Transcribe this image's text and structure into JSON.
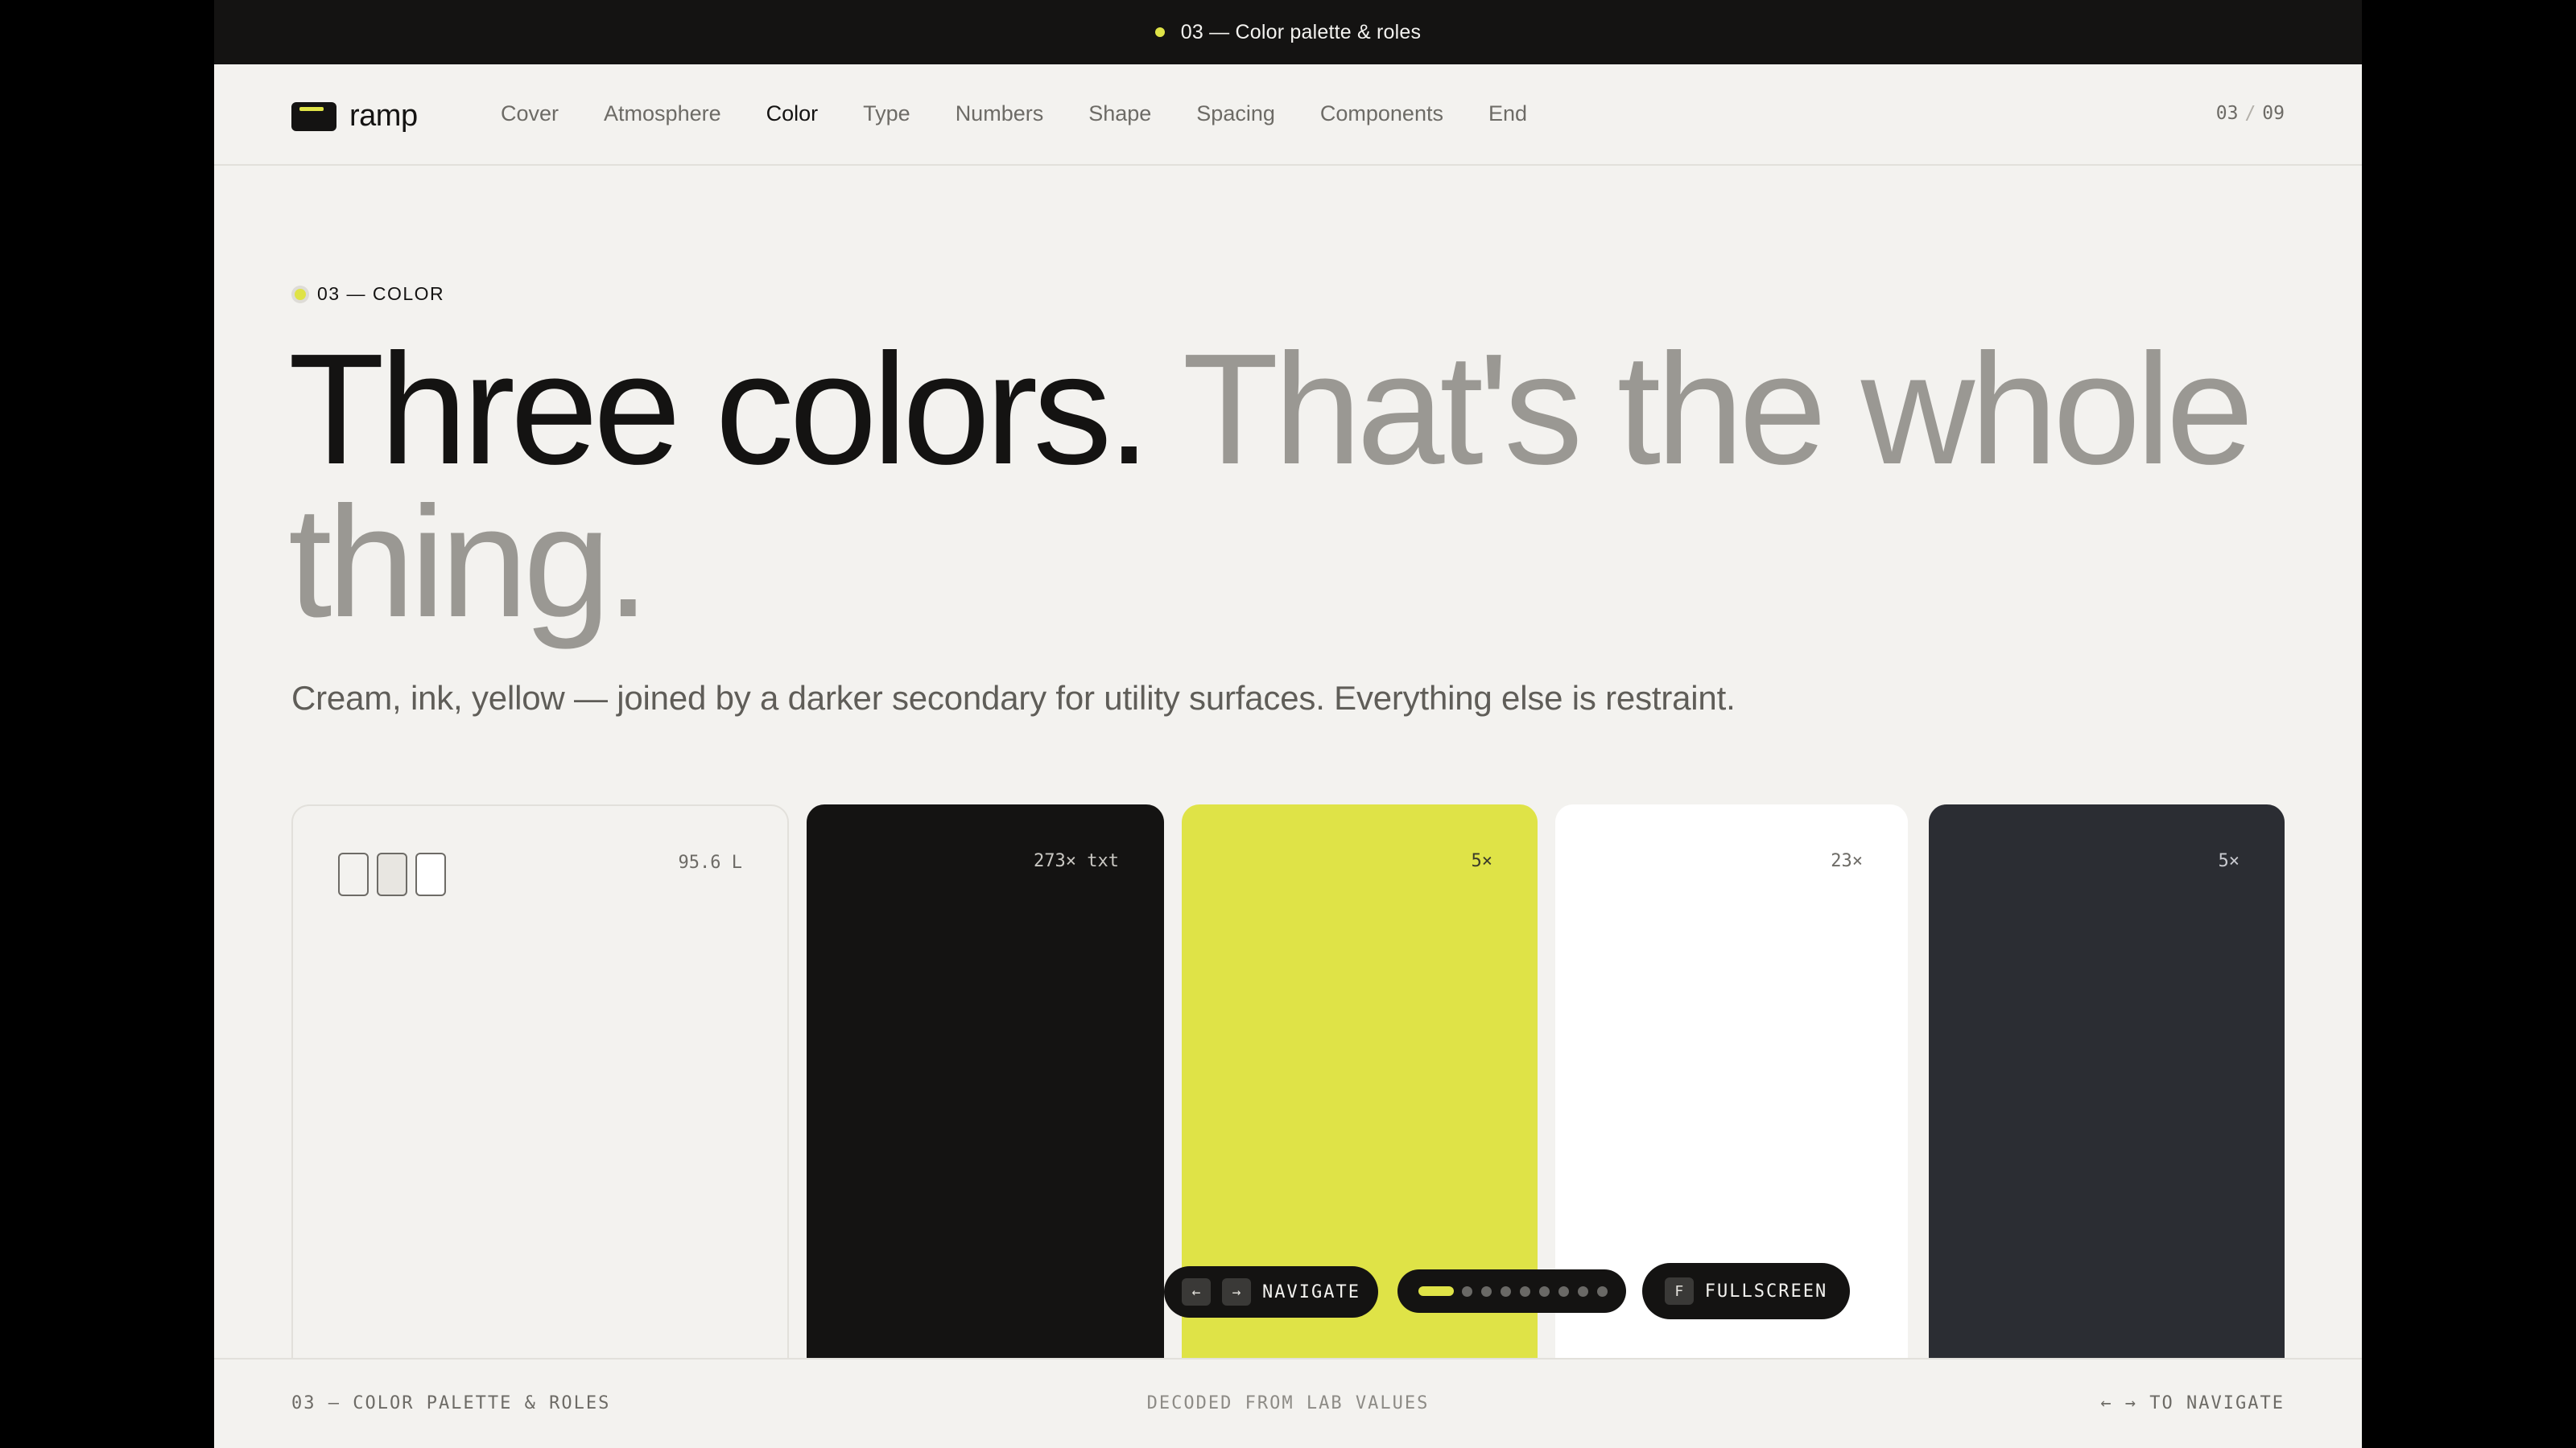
{
  "topbar": {
    "title": "03 — Color palette & roles"
  },
  "brand": {
    "name": "ramp"
  },
  "nav": {
    "items": [
      "Cover",
      "Atmosphere",
      "Color",
      "Type",
      "Numbers",
      "Shape",
      "Spacing",
      "Components",
      "End"
    ],
    "active": "Color",
    "page_current": "03",
    "page_separator": "/",
    "page_total": "09"
  },
  "section": {
    "label": "03 — COLOR"
  },
  "headline": {
    "primary": "Three colors.",
    "secondary": "That's the whole thing."
  },
  "subtitle": "Cream, ink, yellow — joined by a darker secondary for utility surfaces. Everything else is restraint.",
  "swatches": [
    {
      "meta": "95.6 L",
      "color": "#f3f2ef"
    },
    {
      "meta": "273× txt",
      "color": "#141312"
    },
    {
      "meta": "5×",
      "color": "#dfe347"
    },
    {
      "meta": "23×",
      "color": "#ffffff"
    },
    {
      "meta": "5×",
      "color": "#2b2d33"
    }
  ],
  "controls": {
    "prev_key": "←",
    "next_key": "→",
    "navigate_label": "NAVIGATE",
    "progress_current": 1,
    "progress_total": 9,
    "fullscreen_key": "F",
    "fullscreen_label": "FULLSCREEN"
  },
  "footer": {
    "left": "03 — COLOR PALETTE & ROLES",
    "center": "DECODED FROM LAB VALUES",
    "right": "← → TO NAVIGATE"
  },
  "colors": {
    "accent": "#dfe347",
    "ink": "#141312",
    "cream": "#f3f2ef",
    "slate": "#2b2d33"
  }
}
